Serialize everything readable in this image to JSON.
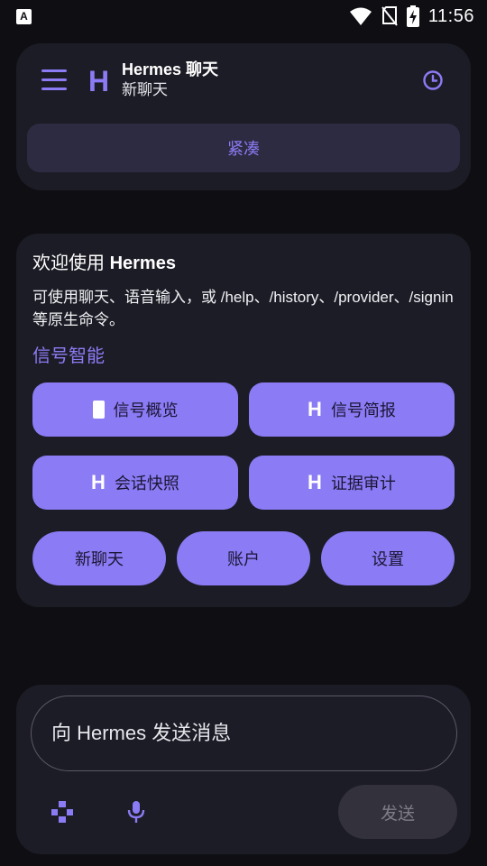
{
  "status_bar": {
    "notification_icon": "A",
    "time": "11:56",
    "icons": [
      "wifi-icon",
      "no-sim-icon",
      "battery-charging-icon"
    ]
  },
  "header": {
    "logo_letter": "H",
    "title": "Hermes 聊天",
    "subtitle": "新聊天",
    "compact_label": "紧凑",
    "icons": [
      "menu-icon",
      "history-icon"
    ]
  },
  "welcome": {
    "title_prefix": "欢迎使用 ",
    "title_brand": "Hermes",
    "body": "可使用聊天、语音输入，或 /help、/history、/provider、/signin 等原生命令。",
    "section_title": "信号智能",
    "signal_buttons": [
      {
        "label": "信号概览",
        "icon": "rectangle-icon"
      },
      {
        "label": "信号简报",
        "icon": "hermes-h-icon",
        "glyph": "H"
      },
      {
        "label": "会话快照",
        "icon": "hermes-h-icon",
        "glyph": "H"
      },
      {
        "label": "证据审计",
        "icon": "hermes-h-icon",
        "glyph": "H"
      }
    ],
    "pill_buttons": [
      {
        "label": "新聊天"
      },
      {
        "label": "账户"
      },
      {
        "label": "设置"
      }
    ]
  },
  "composer": {
    "placeholder": "向 Hermes 发送消息",
    "send_label": "发送",
    "icons": [
      "attach-grid-icon",
      "microphone-icon"
    ]
  },
  "colors": {
    "background": "#0e0e13",
    "card": "#1c1c26",
    "accent": "#8b7bf4",
    "compact_bg": "#2d2b42",
    "send_disabled_bg": "#33323c"
  }
}
